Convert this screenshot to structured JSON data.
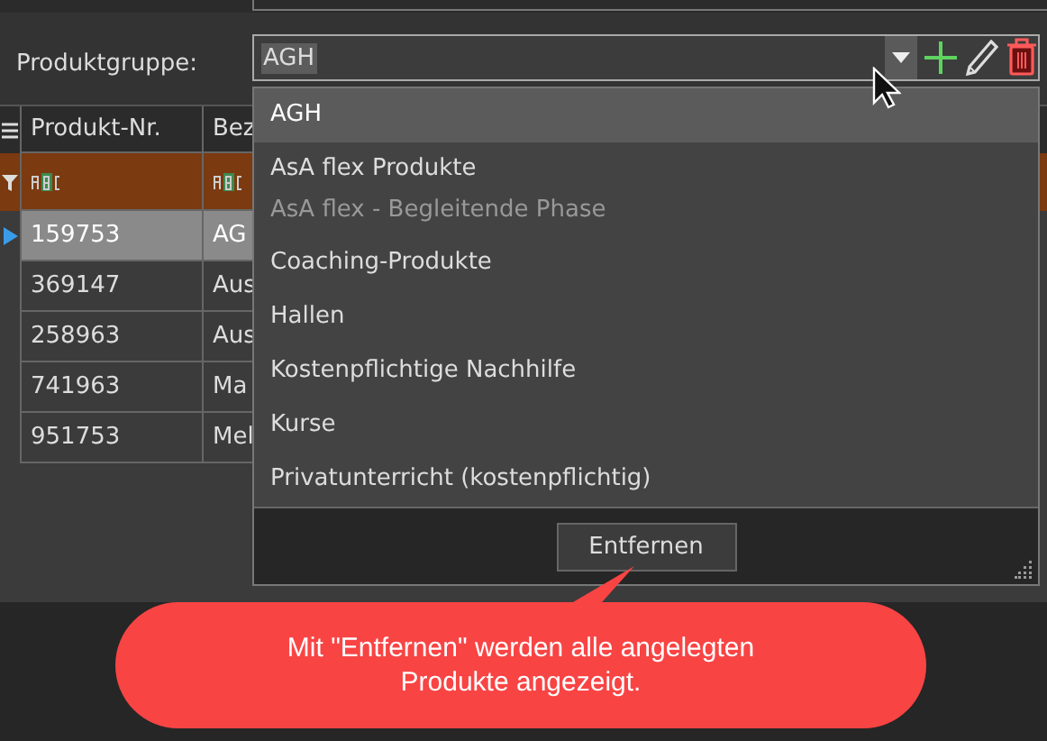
{
  "form": {
    "label": "Produktgruppe:",
    "combo": {
      "value": "AGH"
    }
  },
  "grid": {
    "columns": [
      "Produkt-Nr.",
      "Bez"
    ],
    "rows": [
      {
        "cells": [
          "159753",
          "AG"
        ],
        "selected": true
      },
      {
        "cells": [
          "369147",
          "Aus"
        ],
        "selected": false
      },
      {
        "cells": [
          "258963",
          "Aus"
        ],
        "selected": false
      },
      {
        "cells": [
          "741963",
          "Ma"
        ],
        "selected": false
      },
      {
        "cells": [
          "951753",
          "Mel"
        ],
        "selected": false
      }
    ]
  },
  "dropdown": {
    "items": [
      {
        "label": "AGH",
        "selected": true,
        "disabled": false
      },
      {
        "label": "AsA flex Produkte",
        "selected": false,
        "disabled": false
      },
      {
        "label": "AsA flex - Begleitende Phase",
        "selected": false,
        "disabled": true
      },
      {
        "label": "Coaching-Produkte",
        "selected": false,
        "disabled": false
      },
      {
        "label": "Hallen",
        "selected": false,
        "disabled": false
      },
      {
        "label": "Kostenpflichtige Nachhilfe",
        "selected": false,
        "disabled": false
      },
      {
        "label": "Kurse",
        "selected": false,
        "disabled": false
      },
      {
        "label": "Privatunterricht (kostenpflichtig)",
        "selected": false,
        "disabled": false
      }
    ],
    "button": "Entfernen"
  },
  "callout": {
    "lines": [
      "Mit \"Entfernen\" werden alle angelegten",
      "Produkte angezeigt."
    ]
  }
}
